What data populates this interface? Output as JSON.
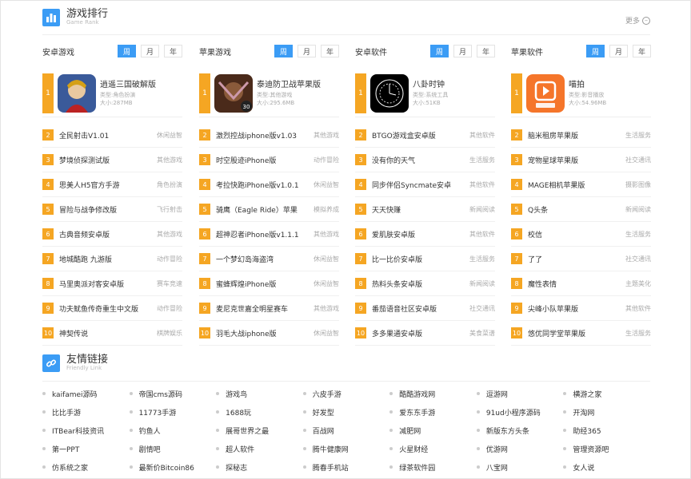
{
  "section": {
    "title": "游戏排行",
    "subtitle": "Game Rank",
    "more": "更多"
  },
  "tabs": [
    "周",
    "月",
    "年"
  ],
  "columns": [
    {
      "title": "安卓游戏",
      "top": {
        "num": "1",
        "name": "逍遥三国破解版",
        "meta1": "类型:角色扮演",
        "meta2": "大小:287MB",
        "thumb": "hero"
      },
      "items": [
        {
          "num": "2",
          "name": "全民射击V1.01",
          "cat": "休闲益智"
        },
        {
          "num": "3",
          "name": "梦境侦探测试版",
          "cat": "其他游戏"
        },
        {
          "num": "4",
          "name": "思美人H5官方手游",
          "cat": "角色扮演"
        },
        {
          "num": "5",
          "name": "冒险与战争修改版",
          "cat": "飞行射击"
        },
        {
          "num": "6",
          "name": "古典音频安卓版",
          "cat": "其他游戏"
        },
        {
          "num": "7",
          "name": "地城酷跑 九游版",
          "cat": "动作冒险"
        },
        {
          "num": "8",
          "name": "马里奥派对客安卓版",
          "cat": "赛车竞速"
        },
        {
          "num": "9",
          "name": "功夫鱿鱼传奇重生中文版",
          "cat": "动作冒险"
        },
        {
          "num": "10",
          "name": "神契传说",
          "cat": "棋牌娱乐"
        }
      ]
    },
    {
      "title": "苹果游戏",
      "top": {
        "num": "1",
        "name": "泰迪防卫战苹果版",
        "meta1": "类型:其他游戏",
        "meta2": "大小:295.6MB",
        "thumb": "warrior"
      },
      "items": [
        {
          "num": "2",
          "name": "激烈控战iphone版v1.03",
          "cat": "其他游戏"
        },
        {
          "num": "3",
          "name": "时空股迹iPhone版",
          "cat": "动作冒险"
        },
        {
          "num": "4",
          "name": "考拉快跑iPhone版v1.0.1",
          "cat": "休闲益智"
        },
        {
          "num": "5",
          "name": "骑鹰（Eagle Ride）苹果",
          "cat": "模拟养成"
        },
        {
          "num": "6",
          "name": "超神忍者iPhone版v1.1.1",
          "cat": "其他游戏"
        },
        {
          "num": "7",
          "name": "一个梦幻岛海盗湾",
          "cat": "休闲益智"
        },
        {
          "num": "8",
          "name": "蜜蜂辉煌iPhone版",
          "cat": "休闲益智"
        },
        {
          "num": "9",
          "name": "麦尼克世嘉全明星赛车",
          "cat": "其他游戏"
        },
        {
          "num": "10",
          "name": "羽毛大战iphone版",
          "cat": "休闲益智"
        }
      ]
    },
    {
      "title": "安卓软件",
      "top": {
        "num": "1",
        "name": "八卦时钟",
        "meta1": "类型:系统工具",
        "meta2": "大小:51KB",
        "thumb": "clock"
      },
      "items": [
        {
          "num": "2",
          "name": "BTGO游戏盒安卓版",
          "cat": "其他软件"
        },
        {
          "num": "3",
          "name": "没有你的天气",
          "cat": "生活服务"
        },
        {
          "num": "4",
          "name": "同步伴侣Syncmate安卓",
          "cat": "其他软件"
        },
        {
          "num": "5",
          "name": "天天快赚",
          "cat": "新闻阅读"
        },
        {
          "num": "6",
          "name": "爱肌肤安卓版",
          "cat": "其他软件"
        },
        {
          "num": "7",
          "name": "比一比价安卓版",
          "cat": "生活服务"
        },
        {
          "num": "8",
          "name": "热料头条安卓版",
          "cat": "新闻阅读"
        },
        {
          "num": "9",
          "name": "番茄语音社区安卓版",
          "cat": "社交通讯"
        },
        {
          "num": "10",
          "name": "多多果通安卓版",
          "cat": "美食菜谱"
        }
      ]
    },
    {
      "title": "苹果软件",
      "top": {
        "num": "1",
        "name": "喵拍",
        "meta1": "类型:影音播放",
        "meta2": "大小:54.96MB",
        "thumb": "video"
      },
      "items": [
        {
          "num": "2",
          "name": "脑米租房苹果版",
          "cat": "生活服务"
        },
        {
          "num": "3",
          "name": "宠物星球苹果版",
          "cat": "社交通讯"
        },
        {
          "num": "4",
          "name": "MAGE相机苹果版",
          "cat": "摄影图像"
        },
        {
          "num": "5",
          "name": "Q头条",
          "cat": "新闻阅读"
        },
        {
          "num": "6",
          "name": "校信",
          "cat": "生活服务"
        },
        {
          "num": "7",
          "name": "了了",
          "cat": "社交通讯"
        },
        {
          "num": "8",
          "name": "魔性表情",
          "cat": "主题美化"
        },
        {
          "num": "9",
          "name": "尖峰小队苹果版",
          "cat": "其他软件"
        },
        {
          "num": "10",
          "name": "悠优同学堂苹果版",
          "cat": "生活服务"
        }
      ]
    }
  ],
  "friend": {
    "title": "友情链接",
    "subtitle": "Friendly Link",
    "links": [
      "kaifamei源码",
      "帝国cms源码",
      "游戏鸟",
      "六皮手游",
      "酷酷游戏网",
      "逗游网",
      "横游之家",
      "比比手游",
      "11773手游",
      "1688玩",
      "好发型",
      "爱东东手游",
      "91ud小程序源码",
      "开淘网",
      "ITBear科技资讯",
      "钓鱼人",
      "展哥世界之最",
      "百战网",
      "减肥网",
      "新版东方头条",
      "助经365",
      "第一PPT",
      "剧情吧",
      "超人软件",
      "腾牛健康网",
      "火星财经",
      "优游网",
      "管理资源吧",
      "仿系统之家",
      "最新价Bitcoin86",
      "探秘志",
      "腾春手机站",
      "绿茶软件园",
      "八宝网",
      "女人说"
    ]
  },
  "colors": {
    "accent": "#3b9cf5",
    "rank": "#f5a623"
  }
}
